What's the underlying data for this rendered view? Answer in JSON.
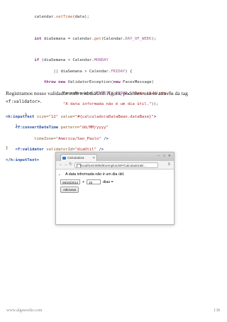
{
  "code1": {
    "l1_a": "            calendar.",
    "l1_fn": "setTime",
    "l1_b": "(data);",
    "l3_kw": "int",
    "l3_a": " diaSemana = calendar.",
    "l3_fn": "get",
    "l3_b": "(Calendar.",
    "l3_const": "DAY_OF_WEEK",
    "l3_c": ");",
    "l5_kw": "if",
    "l5_a": " (diaSemana < Calendar.",
    "l5_const": "MONDAY",
    "l6_a": "                    || diaSemana > Calendar.",
    "l6_const": "FRIDAY",
    "l6_b": ") {",
    "l7_kw1": "throw",
    "l7_kw2": "new",
    "l7_a": " ValidatorException(",
    "l7_kw3": "new",
    "l7_b": " FacesMessage(",
    "l8_a": "                        FacesMessage.",
    "l8_const": "SEVERITY_ERROR",
    "l8_b": ", ",
    "l8_str": "\"Data inválida.\"",
    "l8_c": ",",
    "l9_str": "\"A data informada não é um dia útil.\"",
    "l9_b": "));",
    "l10": "        }",
    "l11": "    }",
    "l13": "}"
  },
  "paragraph": {
    "text_before": "Registramos nosso validador com o id ",
    "id_value": "diaUtil",
    "text_after": ". Agora, podemos usá-lo através da tag",
    "tag_name": "<f:validator>",
    "end": "."
  },
  "code2": {
    "l1_tag": "<h:inputText",
    "l1_attr1": " size=",
    "l1_v1": "\"12\"",
    "l1_attr2": " value=",
    "l1_v2": "\"#{calculadoraDataBean.dataBase}\"",
    "l1_end": ">",
    "l2_tag": "<f:convertDateTime",
    "l2_attr": " pattern=",
    "l2_v": "\"dd/MM/yyyy\"",
    "l3_attr": "            timeZone=",
    "l3_v": "\"America/Sao_Paulo\"",
    "l3_end": " />",
    "l4_tag": "<f:validator",
    "l4_attr": " validatorId=",
    "l4_v": "\"diaUtil\"",
    "l4_end": " />",
    "l5_tag": "</h:inputText>"
  },
  "browser": {
    "tab_title": "Calculadora",
    "address": "localhost:8080/ExemplosJSF/CalculadoraD...",
    "error_message": "A data informada não é um dia útil.",
    "date_value": "05/10/2013",
    "plus_sign": "+",
    "days_value": "10",
    "days_label": "dias =",
    "button_label": "Adicionar"
  },
  "footer": {
    "url": "www.algaworks.com",
    "page_number": "138"
  }
}
